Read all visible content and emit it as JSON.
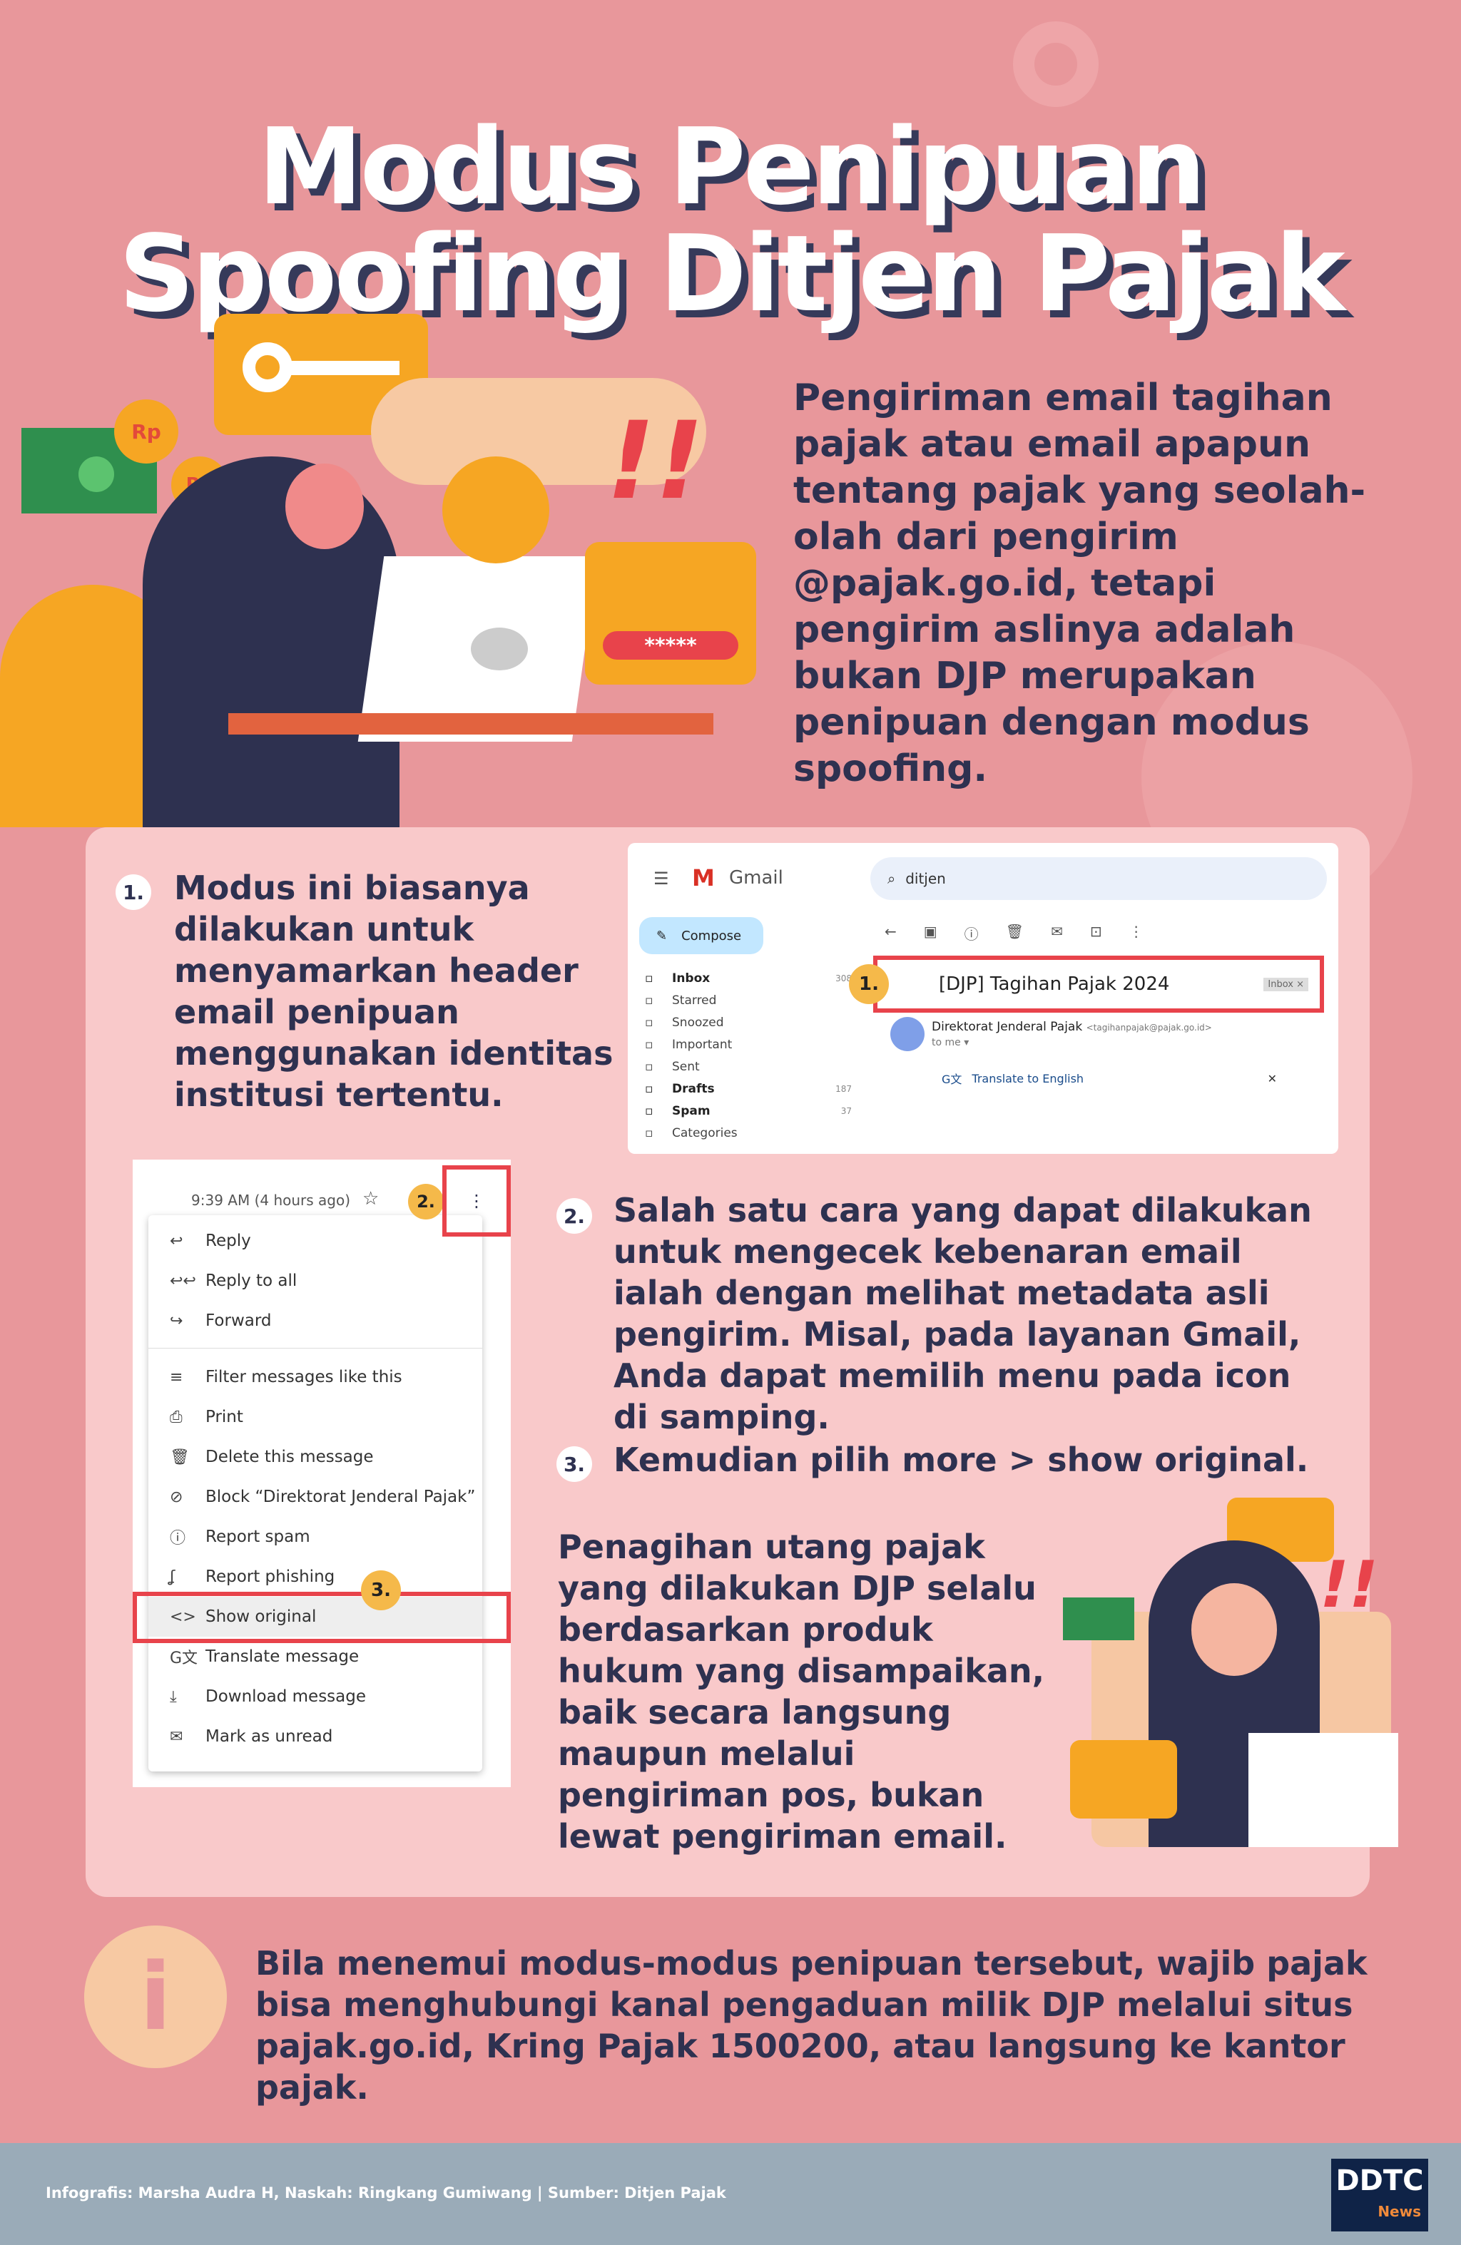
{
  "title": {
    "line1": "Modus Penipuan",
    "line2": "Spoofing Ditjen Pajak"
  },
  "intro": "Pengiriman email tagihan pajak atau email apapun tentang pajak yang seolah-olah dari pengirim @pajak.go.id, tetapi pengirim aslinya adalah bukan DJP merupakan penipuan dengan modus spoofing.",
  "illustration": {
    "coin1": "Rp",
    "coin2": "Rp",
    "password_mask": "*****",
    "alert": "!!"
  },
  "steps": [
    {
      "num": "1.",
      "text": "Modus ini biasanya dilakukan untuk menyamarkan header email penipuan menggunakan identitas institusi tertentu."
    },
    {
      "num": "2.",
      "text": "Salah satu cara yang dapat dilakukan untuk mengecek kebenaran email ialah dengan melihat metadata asli pengirim. Misal, pada layanan Gmail, Anda dapat memilih menu pada icon di samping."
    },
    {
      "num": "3.",
      "text": "Kemudian pilih more > show original."
    }
  ],
  "gmail": {
    "brand": "Gmail",
    "search_value": "ditjen",
    "compose": "Compose",
    "sidebar": [
      {
        "label": "Inbox",
        "count": "308",
        "bold": true,
        "icon": "inbox-icon"
      },
      {
        "label": "Starred",
        "count": "",
        "icon": "star-icon"
      },
      {
        "label": "Snoozed",
        "count": "",
        "icon": "clock-icon"
      },
      {
        "label": "Important",
        "count": "",
        "icon": "important-icon"
      },
      {
        "label": "Sent",
        "count": "",
        "icon": "send-icon"
      },
      {
        "label": "Drafts",
        "count": "187",
        "bold": true,
        "icon": "file-icon"
      },
      {
        "label": "Spam",
        "count": "37",
        "bold": true,
        "icon": "spam-icon"
      },
      {
        "label": "Categories",
        "count": "",
        "icon": "label-icon"
      }
    ],
    "subject": "[DJP] Tagihan Pajak 2024",
    "label_chip": "Inbox ×",
    "badge": "1.",
    "sender_name": "Direktorat Jenderal Pajak",
    "sender_email": "<tagihanpajak@pajak.go.id>",
    "to": "to me ▾",
    "translate": "Translate to English",
    "close": "✕"
  },
  "menu": {
    "time": "9:39 AM (4 hours ago)",
    "badge2": "2.",
    "badge3": "3.",
    "items": [
      {
        "icon": "↩",
        "label": "Reply"
      },
      {
        "icon": "↩↩",
        "label": "Reply to all"
      },
      {
        "icon": "↪",
        "label": "Forward"
      },
      {
        "icon": "≡",
        "label": "Filter messages like this"
      },
      {
        "icon": "⎙",
        "label": "Print"
      },
      {
        "icon": "🗑",
        "label": "Delete this message"
      },
      {
        "icon": "⊘",
        "label": "Block “Direktorat Jenderal Pajak”"
      },
      {
        "icon": "ⓘ",
        "label": "Report spam"
      },
      {
        "icon": "ʆ",
        "label": "Report phishing"
      },
      {
        "icon": "<>",
        "label": "Show original"
      },
      {
        "icon": "G文",
        "label": "Translate message"
      },
      {
        "icon": "⤓",
        "label": "Download message"
      },
      {
        "icon": "✉",
        "label": "Mark as unread"
      }
    ]
  },
  "closing": "Penagihan utang pajak yang dilakukan DJP selalu berdasarkan produk hukum yang disampaikan, baik secara langsung maupun melalui pengiriman pos, bukan lewat pengiriman email.",
  "info": {
    "icon": "i",
    "text": "Bila menemui modus-modus penipuan tersebut, wajib pajak bisa menghubungi kanal pengaduan milik DJP melalui situs pajak.go.id, Kring Pajak 1500200, atau langsung ke kantor pajak."
  },
  "footer": {
    "credits": "Infografis: Marsha Audra H, Naskah: Ringkang Gumiwang | Sumber: Ditjen Pajak",
    "logo": "DDTC",
    "logo_sub": "News"
  },
  "colors": {
    "background": "#e8979b",
    "card": "#f9c9ca",
    "navy": "#2e3150",
    "yellow": "#f5b94a",
    "red": "#e8434b",
    "footer": "#9aabb8"
  }
}
